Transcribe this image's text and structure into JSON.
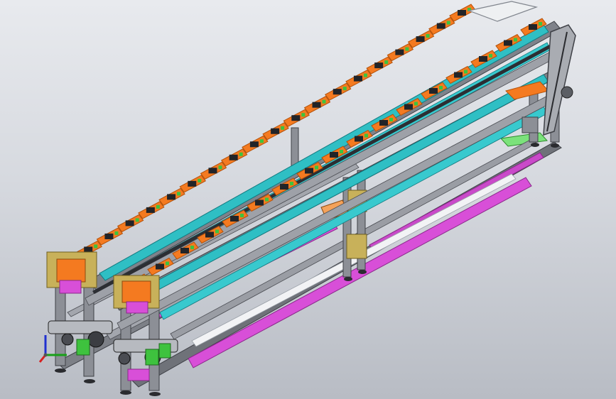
{
  "viewport": {
    "background_top": "#e8eaee",
    "background_bottom": "#b8bcc4"
  },
  "model": {
    "frame_color": "#8c8f96",
    "frame_dark": "#3e4046",
    "conveyor_color": "#2fbfc4",
    "conveyor_dark": "#11797f",
    "pallet_color": "#f47a20",
    "pallet_dark": "#b4520a",
    "fixture_color": "#222428",
    "return_belt_color": "#d84fd8",
    "bracket_color": "#c8b15a",
    "plate_color": "#eef0f2",
    "green_guide_color": "#3ec23e",
    "upper_line_pallet_count": 20,
    "lower_line_pallet_count": 17
  },
  "triad": {
    "icon": "coordinate-triad-icon",
    "x_color": "#d62020",
    "y_color": "#18a018",
    "z_color": "#2030d0"
  }
}
